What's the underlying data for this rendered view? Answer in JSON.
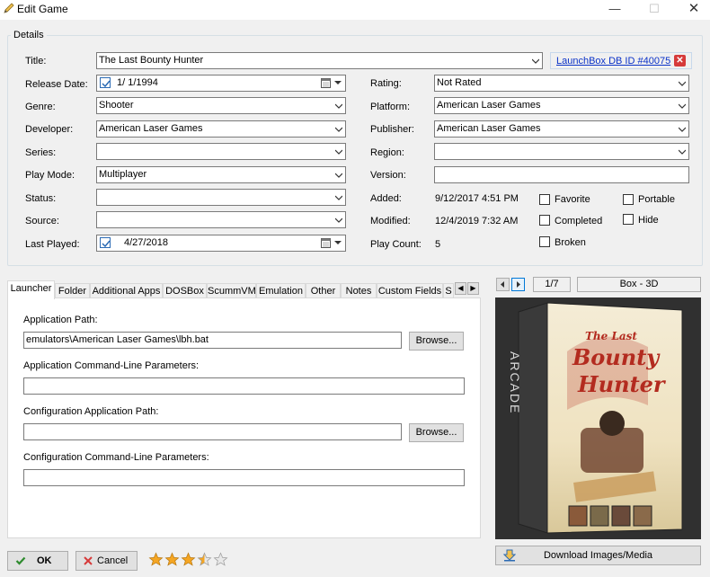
{
  "window": {
    "title": "Edit Game",
    "min": "—",
    "max": "☐",
    "close": "✕"
  },
  "details": {
    "group_label": "Details",
    "title_label": "Title:",
    "title_value": "The Last Bounty Hunter",
    "db_link": "LaunchBox DB ID #40075",
    "release_date_label": "Release Date:",
    "release_date_value": "1/  1/1994",
    "genre_label": "Genre:",
    "genre_value": "Shooter",
    "developer_label": "Developer:",
    "developer_value": "American Laser Games",
    "series_label": "Series:",
    "series_value": "",
    "play_mode_label": "Play Mode:",
    "play_mode_value": "Multiplayer",
    "status_label": "Status:",
    "status_value": "",
    "source_label": "Source:",
    "source_value": "",
    "last_played_label": "Last Played:",
    "last_played_value": "4/27/2018",
    "rating_label": "Rating:",
    "rating_value": "Not Rated",
    "platform_label": "Platform:",
    "platform_value": "American Laser Games",
    "publisher_label": "Publisher:",
    "publisher_value": "American Laser Games",
    "region_label": "Region:",
    "region_value": "",
    "version_label": "Version:",
    "version_value": "",
    "added_label": "Added:",
    "added_value": "9/12/2017 4:51 PM",
    "modified_label": "Modified:",
    "modified_value": "12/4/2019 7:32 AM",
    "play_count_label": "Play Count:",
    "play_count_value": "5",
    "favorite_label": "Favorite",
    "completed_label": "Completed",
    "broken_label": "Broken",
    "portable_label": "Portable",
    "hide_label": "Hide"
  },
  "tabs": [
    {
      "label": "Launcher"
    },
    {
      "label": "Folder"
    },
    {
      "label": "Additional Apps"
    },
    {
      "label": "DOSBox"
    },
    {
      "label": "ScummVM"
    },
    {
      "label": "Emulation"
    },
    {
      "label": "Other"
    },
    {
      "label": "Notes"
    },
    {
      "label": "Custom Fields"
    },
    {
      "label": "S"
    }
  ],
  "launcher": {
    "app_path_label": "Application Path:",
    "app_path_value": "emulators\\American Laser Games\\lbh.bat",
    "browse_label": "Browse...",
    "cmdline_label": "Application Command-Line Parameters:",
    "cmdline_value": "",
    "config_path_label": "Configuration Application Path:",
    "config_path_value": "",
    "config_cmdline_label": "Configuration Command-Line Parameters:",
    "config_cmdline_value": ""
  },
  "media": {
    "counter": "1/7",
    "image_type": "Box - 3D",
    "download_label": "Download Images/Media",
    "box_spine_text": "ARCADE",
    "box_title_line1": "The Last",
    "box_title_line2": "Bounty",
    "box_title_line3": "Hunter"
  },
  "footer": {
    "ok_label": "OK",
    "cancel_label": "Cancel",
    "rating_stars": 3.5,
    "rating_max": 5
  },
  "colors": {
    "accent_blue": "#0078d7",
    "link": "#0a32c8",
    "ok_green": "#2e8b2e",
    "cancel_red": "#d63a3a",
    "star": "#f5a623"
  }
}
